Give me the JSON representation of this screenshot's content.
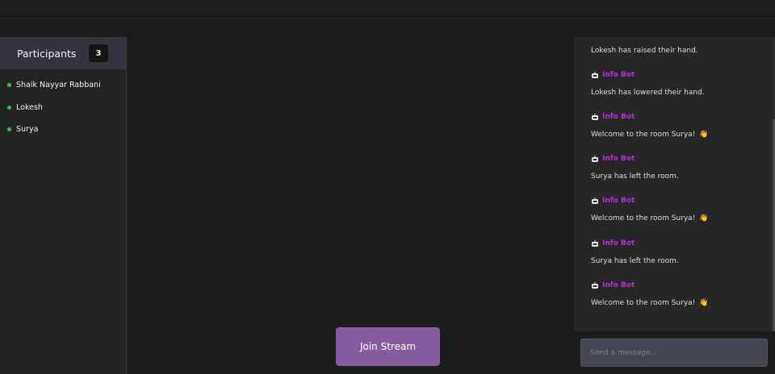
{
  "participants": {
    "title": "Participants",
    "count": "3",
    "list": [
      {
        "name": "Shaik Nayyar Rabbani"
      },
      {
        "name": "Lokesh"
      },
      {
        "name": "Surya"
      }
    ],
    "status_color": "#3dba4e"
  },
  "stage": {
    "join_label": "Join Stream",
    "accent": "#865b9f"
  },
  "chat": {
    "bot_name": "Info Bot",
    "bot_color": "#b62fd6",
    "bot_icon": "robot-icon",
    "wave_icon": "waving-hand-icon",
    "messages": [
      {
        "author": "",
        "text": "Lokesh has raised their hand."
      },
      {
        "author": "Info Bot",
        "text": "Lokesh has lowered their hand."
      },
      {
        "author": "Info Bot",
        "text": "Welcome to the room Surya!",
        "wave": "👋"
      },
      {
        "author": "Info Bot",
        "text": "Surya has left the room."
      },
      {
        "author": "Info Bot",
        "text": "Welcome to the room Surya!",
        "wave": "👋"
      },
      {
        "author": "Info Bot",
        "text": "Surya has left the room."
      },
      {
        "author": "Info Bot",
        "text": "Welcome to the room Surya!",
        "wave": "👋"
      }
    ],
    "input_placeholder": "Send a message..."
  }
}
